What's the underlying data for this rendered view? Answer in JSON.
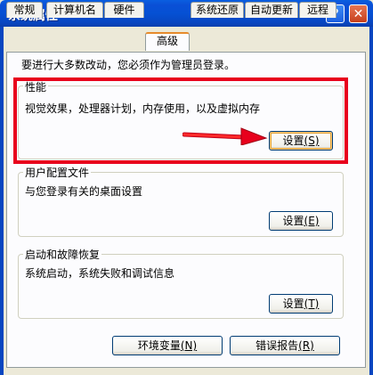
{
  "window": {
    "title": "系统属性",
    "help_label": "?",
    "close_label": "✕"
  },
  "tabs": [
    {
      "label": "常规"
    },
    {
      "label": "计算机名"
    },
    {
      "label": "硬件"
    },
    {
      "label": "高级",
      "active": true
    },
    {
      "label": "系统还原"
    },
    {
      "label": "自动更新"
    },
    {
      "label": "远程"
    }
  ],
  "notice": "要进行大多数改动，您必须作为管理员登录。",
  "performance": {
    "legend": "性能",
    "description": "视觉效果，处理器计划，内存使用，以及虚拟内存",
    "button_label": "设置",
    "button_hotkey": "(S)"
  },
  "user_profiles": {
    "legend": "用户配置文件",
    "description": "与您登录有关的桌面设置",
    "button_label": "设置",
    "button_hotkey": "(E)"
  },
  "startup_recovery": {
    "legend": "启动和故障恢复",
    "description": "系统启动，系统失败和调试信息",
    "button_label": "设置",
    "button_hotkey": "(T)"
  },
  "bottom_buttons": {
    "env_label": "环境变量",
    "env_hotkey": "(N)",
    "error_label": "错误报告",
    "error_hotkey": "(R)"
  },
  "annotation": {
    "highlight_color": "#e8001c",
    "arrow_icon": "red-arrow-right"
  }
}
